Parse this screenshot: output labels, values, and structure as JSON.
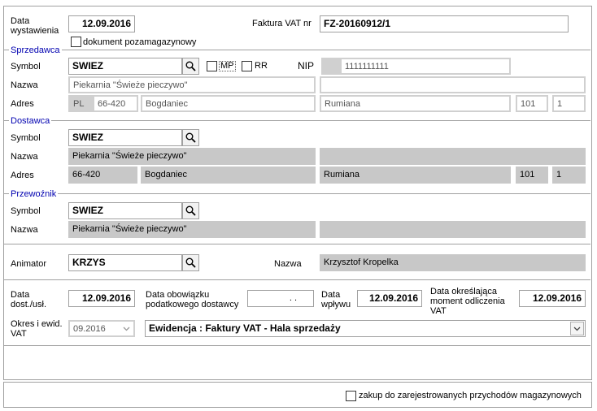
{
  "header": {
    "data_wystawienia_label": "Data wystawienia",
    "data_wystawienia": "12.09.2016",
    "faktura_label": "Faktura VAT nr",
    "faktura_nr": "FZ-20160912/1",
    "pozamagazynowy_label": "dokument pozamagazynowy"
  },
  "sprzedawca": {
    "section": "Sprzedawca",
    "symbol_label": "Symbol",
    "symbol": "SWIEZ",
    "mp_label": "MP",
    "rr_label": "RR",
    "nip_label": "NIP",
    "nip": "1111111111",
    "nazwa_label": "Nazwa",
    "nazwa": "Piekarnia \"Świeże pieczywo\"",
    "adres_label": "Adres",
    "kraj": "PL",
    "kod": "66-420",
    "miasto": "Bogdaniec",
    "ulica": "Rumiana",
    "nr_domu": "101",
    "nr_lokalu": "1"
  },
  "dostawca": {
    "section": "Dostawca",
    "symbol_label": "Symbol",
    "symbol": "SWIEZ",
    "nazwa_label": "Nazwa",
    "nazwa": "Piekarnia \"Świeże pieczywo\"",
    "adres_label": "Adres",
    "kod": "66-420",
    "miasto": "Bogdaniec",
    "ulica": "Rumiana",
    "nr_domu": "101",
    "nr_lokalu": "1"
  },
  "przewoznik": {
    "section": "Przewoźnik",
    "symbol_label": "Symbol",
    "symbol": "SWIEZ",
    "nazwa_label": "Nazwa",
    "nazwa": "Piekarnia \"Świeże pieczywo\""
  },
  "animator": {
    "label": "Animator",
    "symbol": "KRZYS",
    "nazwa_label": "Nazwa",
    "nazwa": "Krzysztof Kropelka"
  },
  "dates": {
    "dost_label": "Data dost./usł.",
    "dost": "12.09.2016",
    "obowiazek_label": "Data obowiązku podatkowego dostawcy",
    "obowiazek": ". .",
    "wplyw_label": "Data wpływu",
    "wplyw": "12.09.2016",
    "odliczenie_label": "Data określająca moment odliczenia VAT",
    "odliczenie": "12.09.2016",
    "okres_label": "Okres i ewid. VAT",
    "okres": "09.2016",
    "ewidencja": "Ewidencja : Faktury VAT - Hala sprzedaży"
  },
  "footer": {
    "zakup_label": "zakup do zarejestrowanych przychodów magazynowych"
  }
}
